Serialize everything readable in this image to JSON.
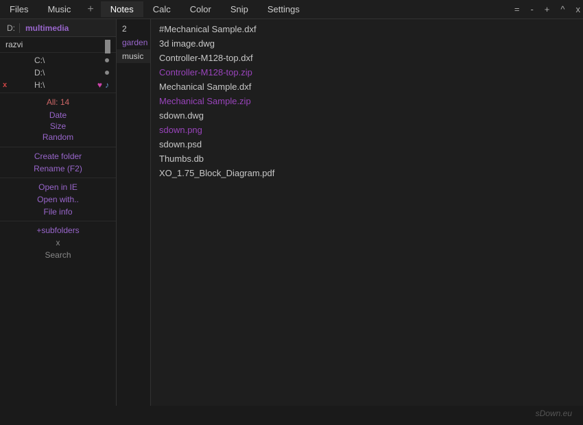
{
  "menubar": {
    "tabs": [
      {
        "id": "files",
        "label": "Files",
        "active": false
      },
      {
        "id": "music",
        "label": "Music",
        "active": false
      },
      {
        "id": "add",
        "label": "+",
        "active": false
      },
      {
        "id": "notes",
        "label": "Notes",
        "active": true
      },
      {
        "id": "calc",
        "label": "Calc",
        "active": false
      },
      {
        "id": "color",
        "label": "Color",
        "active": false
      },
      {
        "id": "snip",
        "label": "Snip",
        "active": false
      },
      {
        "id": "settings",
        "label": "Settings",
        "active": false
      }
    ],
    "window_controls": [
      "=",
      "-",
      "+",
      "^",
      "x"
    ]
  },
  "left_panel": {
    "drive_label": "D:",
    "current_folder": "multimedia",
    "user": "razvi",
    "drives": [
      {
        "label": "C:\\",
        "has_dot": true
      },
      {
        "label": "D:\\",
        "has_dot": true
      },
      {
        "label": "H:\\",
        "has_heart": true,
        "has_music": true,
        "has_x": true
      }
    ],
    "stats": {
      "all_label": "All: 14",
      "sort_options": [
        "Date",
        "Size",
        "Random"
      ]
    },
    "actions": [
      {
        "label": "Create folder",
        "color": "purple"
      },
      {
        "label": "Rename (F2)",
        "color": "purple"
      }
    ],
    "open_actions": [
      {
        "label": "Open in IE"
      },
      {
        "label": "Open with.."
      },
      {
        "label": "File info"
      }
    ],
    "bottom_actions": [
      {
        "label": "+subfolders",
        "color": "purple"
      },
      {
        "label": "x",
        "color": "gray"
      },
      {
        "label": "Search",
        "color": "gray"
      }
    ]
  },
  "folder_list": {
    "items": [
      {
        "id": "num",
        "label": "2"
      },
      {
        "id": "garden",
        "label": "garden"
      },
      {
        "id": "music",
        "label": "music"
      }
    ]
  },
  "files": {
    "items": [
      {
        "name": "#Mechanical Sample.dxf",
        "type": "normal"
      },
      {
        "name": "3d image.dwg",
        "type": "normal"
      },
      {
        "name": "Controller-M128-top.dxf",
        "type": "normal"
      },
      {
        "name": "Controller-M128-top.zip",
        "type": "zip"
      },
      {
        "name": "Mechanical Sample.dxf",
        "type": "normal"
      },
      {
        "name": "Mechanical Sample.zip",
        "type": "zip"
      },
      {
        "name": "sdown.dwg",
        "type": "normal"
      },
      {
        "name": "sdown.png",
        "type": "png"
      },
      {
        "name": "sdown.psd",
        "type": "normal"
      },
      {
        "name": "Thumbs.db",
        "type": "normal"
      },
      {
        "name": "XO_1.75_Block_Diagram.pdf",
        "type": "normal"
      }
    ]
  },
  "branding": "sDown.eu"
}
